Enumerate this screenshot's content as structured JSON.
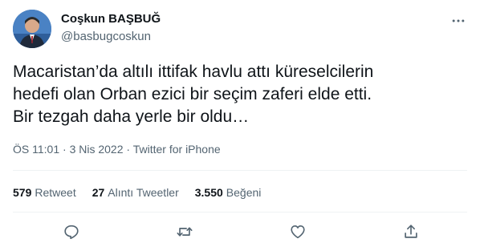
{
  "author": {
    "name": "Coşkun BAŞBUĞ",
    "handle": "@basbugcoskun"
  },
  "tweet": {
    "text": "Macaristan’da altılı ittifak havlu attı küreselcilerin\nhedefi olan Orban ezici bir seçim zaferi elde etti.\nBir tezgah daha yerle bir oldu…",
    "time": "ÖS 11:01",
    "separator": "·",
    "date": "3 Nis 2022",
    "source": "Twitter for iPhone"
  },
  "stats": {
    "retweets": {
      "count": "579",
      "label": "Retweet"
    },
    "quotes": {
      "count": "27",
      "label": "Alıntı Tweetler"
    },
    "likes": {
      "count": "3.550",
      "label": "Beğeni"
    }
  },
  "icons": {
    "more": "more-horizontal-icon",
    "reply": "reply-icon",
    "retweet": "retweet-icon",
    "like": "heart-icon",
    "share": "share-icon"
  },
  "colors": {
    "text_primary": "#0f1419",
    "text_secondary": "#536471",
    "divider": "#eff3f4"
  }
}
